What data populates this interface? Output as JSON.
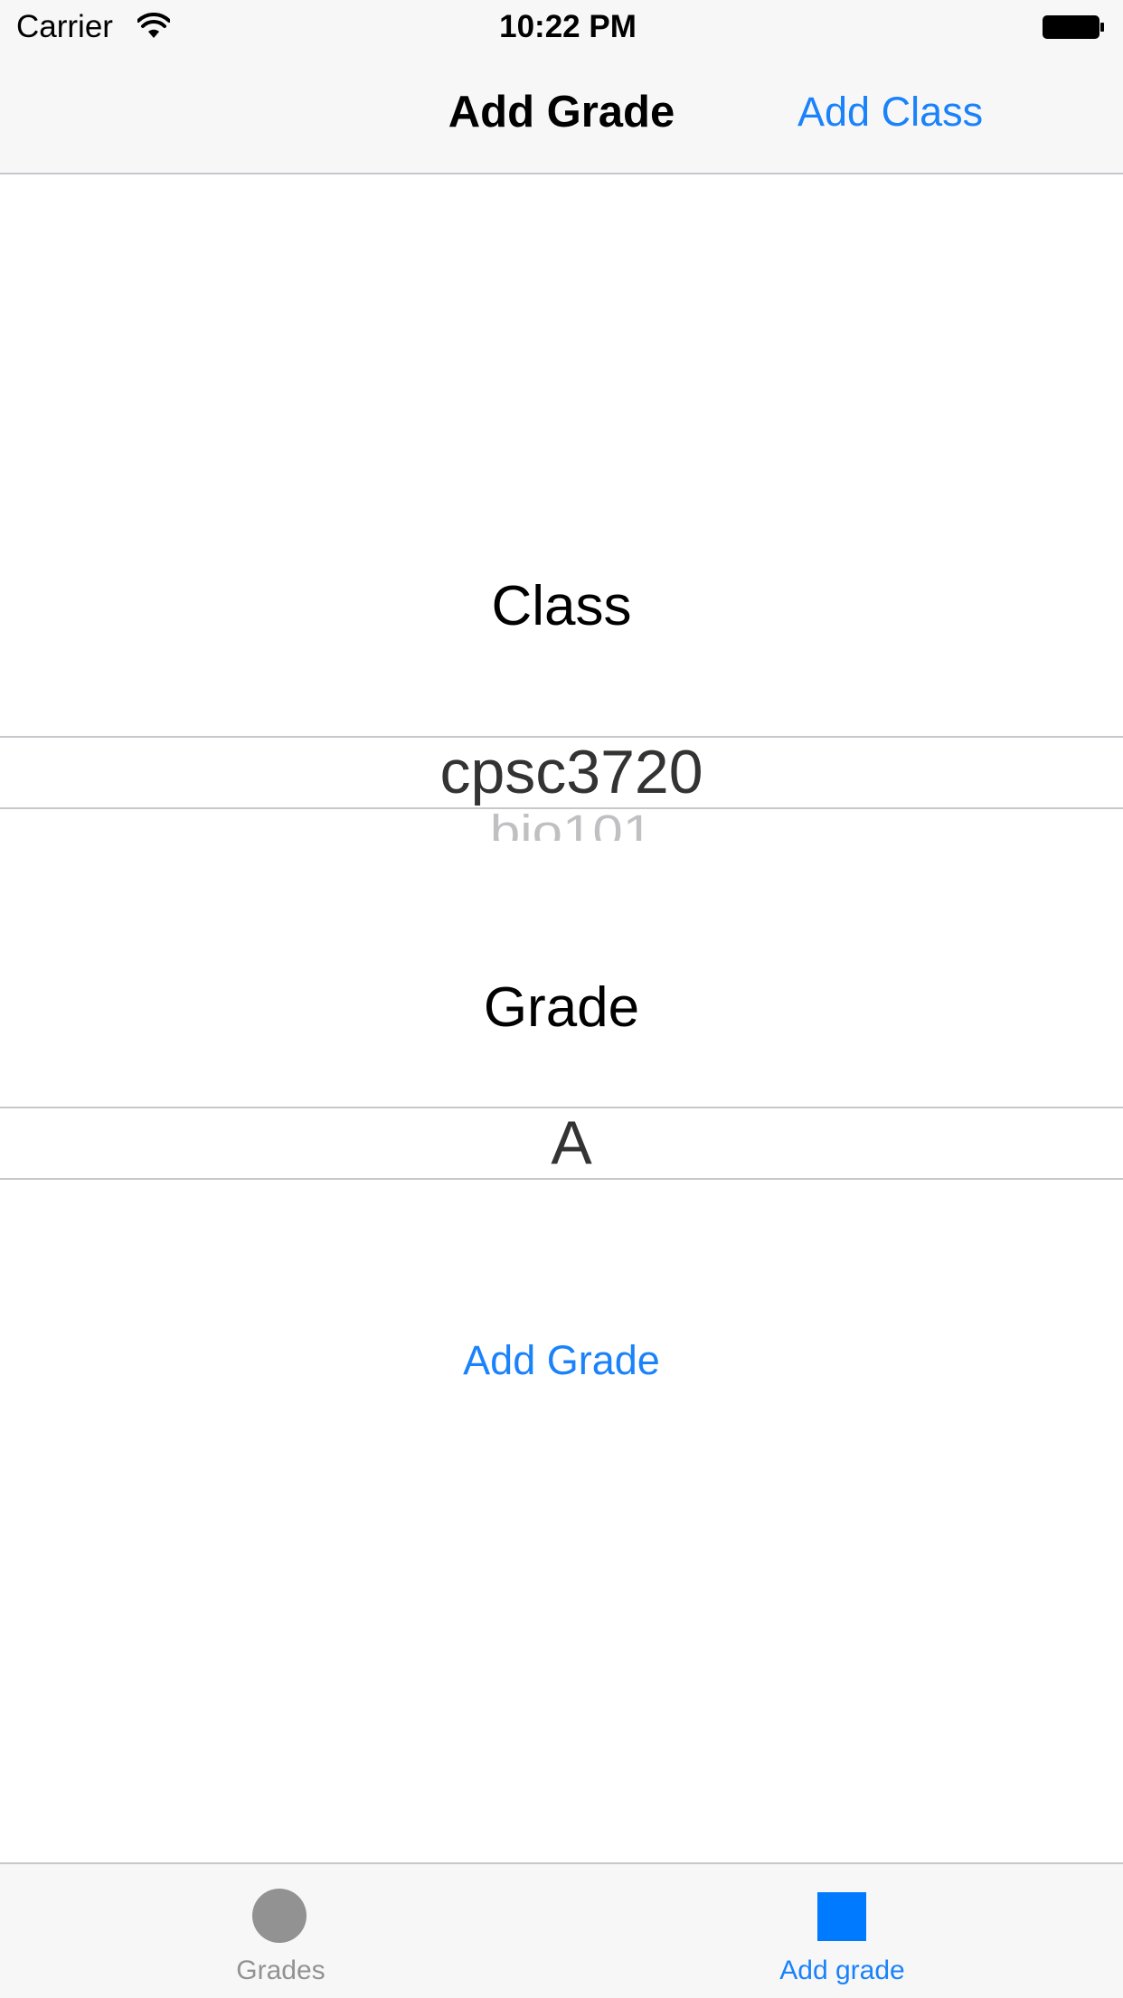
{
  "status_bar": {
    "carrier": "Carrier",
    "time": "10:22 PM",
    "icons": [
      "wifi-icon",
      "battery-icon"
    ]
  },
  "nav": {
    "title": "Add Grade",
    "right_button": "Add Class"
  },
  "class_section": {
    "label": "Class",
    "picker": {
      "selected": "cpsc3720",
      "next_option": "bio101"
    }
  },
  "grade_section": {
    "label": "Grade",
    "picker": {
      "selected": "A"
    }
  },
  "actions": {
    "add_grade": "Add Grade"
  },
  "tab_bar": {
    "tabs": [
      {
        "label": "Grades",
        "icon": "circle-icon",
        "selected": false
      },
      {
        "label": "Add grade",
        "icon": "square-icon",
        "selected": true
      }
    ]
  },
  "colors": {
    "accent": "#1a82fb",
    "tab_selected": "#007aff",
    "tab_unselected": "#929292",
    "bar_background": "#f7f7f7",
    "separator": "#c8c7cc"
  }
}
